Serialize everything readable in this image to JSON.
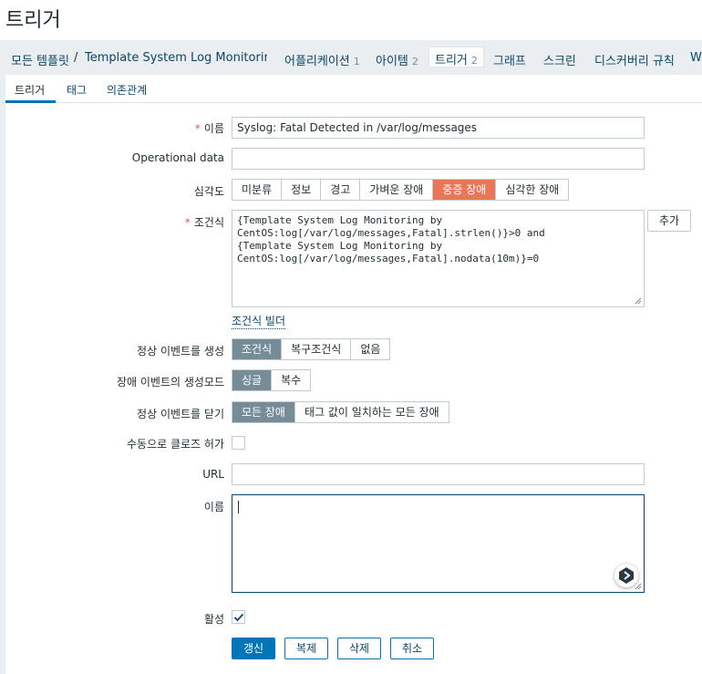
{
  "page": {
    "title": "트리거"
  },
  "navbar": {
    "breadcrumb_root": "모든 템플릿",
    "breadcrumb_sep": "/",
    "breadcrumb_template": "Template System Log Monitoring b...",
    "tabs": [
      {
        "label": "어플리케이션",
        "count": "1"
      },
      {
        "label": "아이템",
        "count": "2"
      },
      {
        "label": "트리거",
        "count": "2"
      },
      {
        "label": "그래프",
        "count": ""
      },
      {
        "label": "스크린",
        "count": ""
      },
      {
        "label": "디스커버리 규칙",
        "count": ""
      },
      {
        "label": "We",
        "count": ""
      }
    ]
  },
  "subtabs": [
    {
      "label": "트리거"
    },
    {
      "label": "태그"
    },
    {
      "label": "의존관계"
    }
  ],
  "form": {
    "name": {
      "label": "이름",
      "value": "Syslog: Fatal Detected in /var/log/messages"
    },
    "opdata": {
      "label": "Operational data",
      "value": ""
    },
    "severity": {
      "label": "심각도",
      "options": [
        "미분류",
        "정보",
        "경고",
        "가벼운 장애",
        "중증 장애",
        "심각한 장애"
      ],
      "selected": "중증 장애",
      "selected_color": "#e97659"
    },
    "expression": {
      "label": "조건식",
      "value": "{Template System Log Monitoring by\nCentOS:log[/var/log/messages,Fatal].strlen()}>0 and\n{Template System Log Monitoring by\nCentOS:log[/var/log/messages,Fatal].nodata(10m)}=0",
      "add_button": "추가",
      "builder_link": "조건식 빌더"
    },
    "ok_event": {
      "label": "정상 이벤트를 생성",
      "options": [
        "조건식",
        "복구조건식",
        "없음"
      ],
      "selected": "조건식"
    },
    "problem_mode": {
      "label": "장애 이벤트의 생성모드",
      "options": [
        "싱글",
        "복수"
      ],
      "selected": "싱글"
    },
    "ok_close": {
      "label": "정상 이벤트를 닫기",
      "options": [
        "모든 장애",
        "태그 값이 일치하는 모든 장애"
      ],
      "selected": "모든 장애"
    },
    "manual_close": {
      "label": "수동으로 클로즈 허가",
      "checked": false
    },
    "url": {
      "label": "URL",
      "value": ""
    },
    "description": {
      "label": "이름",
      "value": ""
    },
    "enabled": {
      "label": "활성",
      "checked": true
    },
    "buttons": {
      "update": "갱신",
      "clone": "복제",
      "delete": "삭제",
      "cancel": "취소"
    }
  },
  "icons": {
    "resize": "resize-handle-icon",
    "checkmark": "checkmark-icon",
    "assistant": "assistant-bubble-icon"
  },
  "colors": {
    "accent": "#0275b8",
    "link": "#0a466a",
    "required": "#e45959"
  }
}
